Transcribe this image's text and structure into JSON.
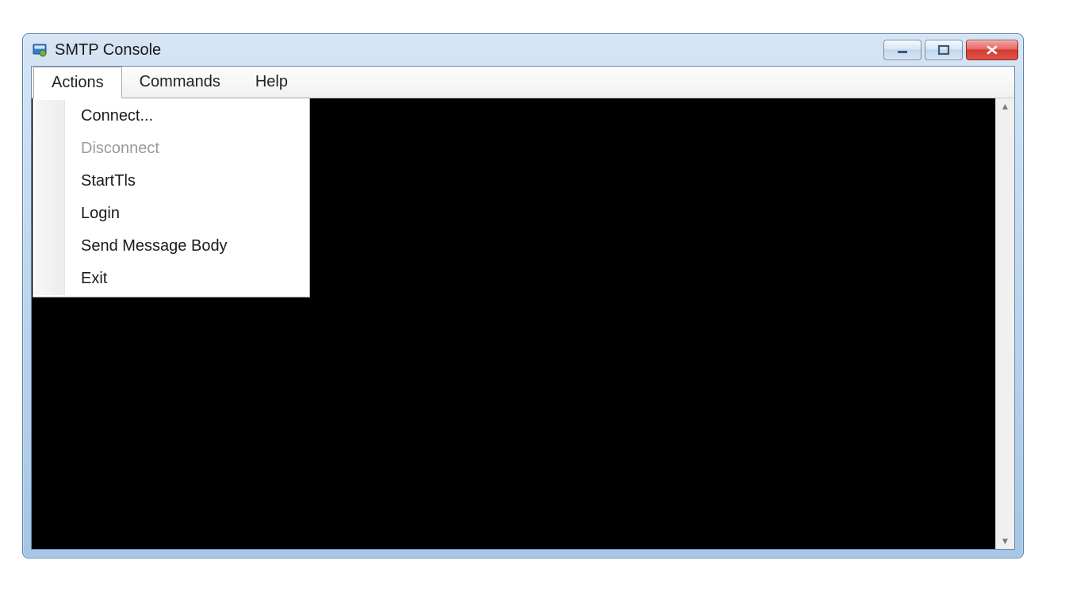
{
  "window": {
    "title": "SMTP Console"
  },
  "menubar": {
    "items": [
      {
        "label": "Actions",
        "open": true
      },
      {
        "label": "Commands",
        "open": false
      },
      {
        "label": "Help",
        "open": false
      }
    ]
  },
  "actions_menu": {
    "items": [
      {
        "label": "Connect...",
        "disabled": false
      },
      {
        "label": "Disconnect",
        "disabled": true
      },
      {
        "label": "StartTls",
        "disabled": false
      },
      {
        "label": "Login",
        "disabled": false
      },
      {
        "label": "Send Message Body",
        "disabled": false
      },
      {
        "label": "Exit",
        "disabled": false
      }
    ]
  },
  "console": {
    "content": "("
  }
}
